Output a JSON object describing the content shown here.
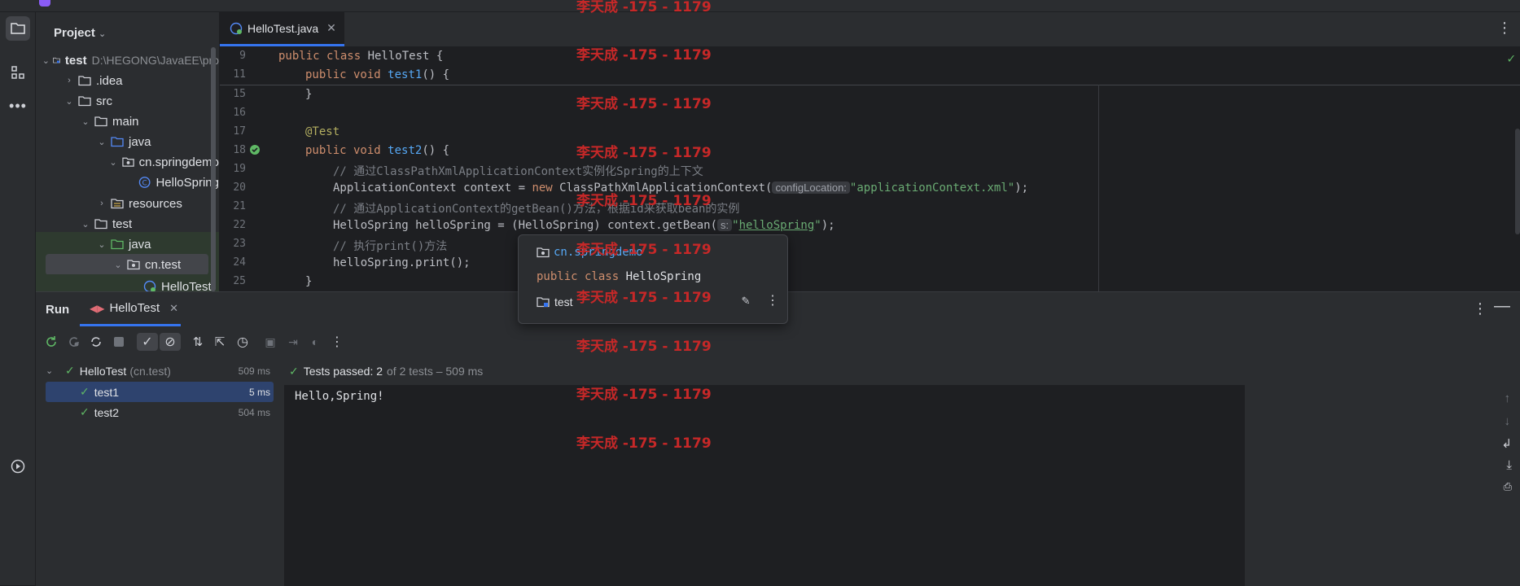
{
  "project_panel": {
    "title": "Project",
    "tree": [
      {
        "label": "test",
        "path": "D:\\HEGONG\\JavaEE\\pro"
      },
      {
        "label": ".idea"
      },
      {
        "label": "src"
      },
      {
        "label": "main"
      },
      {
        "label": "java"
      },
      {
        "label": "cn.springdemo"
      },
      {
        "label": "HelloSpring"
      },
      {
        "label": "resources"
      },
      {
        "label": "test"
      },
      {
        "label": "java"
      },
      {
        "label": "cn.test"
      },
      {
        "label": "HelloTest"
      }
    ]
  },
  "editor": {
    "tab_label": "HelloTest.java",
    "lines": [
      {
        "num": "9"
      },
      {
        "num": "11"
      },
      {
        "num": "15"
      },
      {
        "num": "16"
      },
      {
        "num": "17"
      },
      {
        "num": "18"
      },
      {
        "num": "19"
      },
      {
        "num": "20"
      },
      {
        "num": "21"
      },
      {
        "num": "22"
      },
      {
        "num": "23"
      },
      {
        "num": "24"
      },
      {
        "num": "25"
      }
    ],
    "code": {
      "l9_kw": "public class ",
      "l9_rest": "HelloTest {",
      "l11_kw": "public void ",
      "l11_fn": "test1",
      "l11_rest": "() {",
      "l15": "}",
      "l17_ann": "@Test",
      "l18_kw": "public void ",
      "l18_fn": "test2",
      "l18_rest": "() {",
      "l19_cmt": "// 通过ClassPathXmlApplicationContext实例化Spring的上下文",
      "l20_a": "ApplicationContext context = ",
      "l20_kw": "new ",
      "l20_b": "ClassPathXmlApplicationContext(",
      "l20_hint": "configLocation:",
      "l20_str": "\"applicationContext.xml\"",
      "l20_end": ");",
      "l21_cmt": "// 通过ApplicationContext的getBean()方法，根据id来获取bean的实例",
      "l22_a": "HelloSpring helloSpring = (HelloSpring) context.getBean(",
      "l22_hint": "s:",
      "l22_q1": "\"",
      "l22_str": "helloSpring",
      "l22_q2": "\"",
      "l22_end": ");",
      "l23_cmt": "// 执行print()方法",
      "l24": "helloSpring.print();",
      "l25": "}"
    }
  },
  "popup": {
    "package": "cn.springdemo",
    "decl_kw": "public class ",
    "decl_name": "HelloSpring",
    "module": "test"
  },
  "run_panel": {
    "title": "Run",
    "tab_label": "HelloTest",
    "tests": [
      {
        "name": "HelloTest",
        "suffix": "(cn.test)",
        "time": "509 ms"
      },
      {
        "name": "test1",
        "time": "5 ms"
      },
      {
        "name": "test2",
        "time": "504 ms"
      }
    ],
    "status_prefix": "Tests passed: 2",
    "status_suffix": "of 2 tests – 509 ms",
    "console_output": "Hello,Spring!"
  },
  "watermark": "李天成 -175 - 1179",
  "colors": {
    "accent": "#3574f0",
    "keyword": "#cf8e6d",
    "function": "#56a8f5",
    "string": "#6aab73",
    "comment": "#7a7e85",
    "annotation": "#b3ae60",
    "success": "#5fb865",
    "watermark": "#c62828"
  }
}
